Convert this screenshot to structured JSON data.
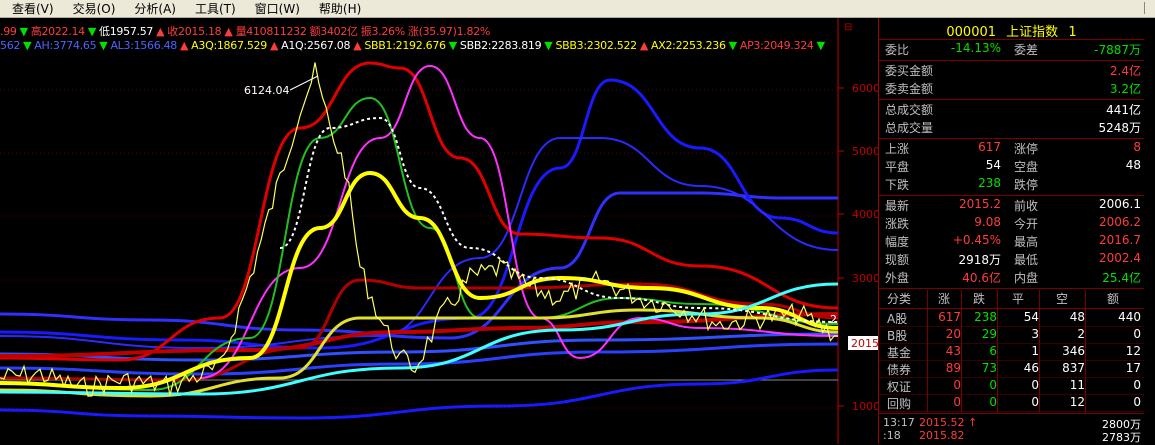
{
  "menu": [
    "查看(V)",
    "交易(O)",
    "分析(A)",
    "工具(T)",
    "窗口(W)",
    "帮助(H)"
  ],
  "info_line1": [
    {
      "t": ".99",
      "c": "c-red"
    },
    {
      "t": "▼",
      "c": "c-grn"
    },
    {
      "t": "高2022.14",
      "c": "c-red"
    },
    {
      "t": "▼",
      "c": "c-grn"
    },
    {
      "t": "低1957.57",
      "c": "c-wht"
    },
    {
      "t": "▲",
      "c": "c-red"
    },
    {
      "t": "收2015.18",
      "c": "c-red"
    },
    {
      "t": "▲",
      "c": "c-red"
    },
    {
      "t": "量410811232",
      "c": "c-red"
    },
    {
      "t": "额3402亿",
      "c": "c-red"
    },
    {
      "t": "振3.26%",
      "c": "c-red"
    },
    {
      "t": "涨(35.97)1.82%",
      "c": "c-red"
    }
  ],
  "info_line2": [
    {
      "t": "562",
      "c": "c-blu"
    },
    {
      "t": "▼",
      "c": "c-grn"
    },
    {
      "t": "AH:3774.65",
      "c": "c-blu"
    },
    {
      "t": "▼",
      "c": "c-grn"
    },
    {
      "t": "AL3:1566.48",
      "c": "c-blu"
    },
    {
      "t": "▲",
      "c": "c-red"
    },
    {
      "t": "A3Q:1867.529",
      "c": "c-yel"
    },
    {
      "t": "▲",
      "c": "c-red"
    },
    {
      "t": "A1Q:2567.08",
      "c": "c-wht"
    },
    {
      "t": "▲",
      "c": "c-red"
    },
    {
      "t": "SBB1:2192.676",
      "c": "c-yel"
    },
    {
      "t": "▼",
      "c": "c-grn"
    },
    {
      "t": "SBB2:2283.819",
      "c": "c-wht"
    },
    {
      "t": "▼",
      "c": "c-grn"
    },
    {
      "t": "SBB3:2302.522",
      "c": "c-yel"
    },
    {
      "t": "▲",
      "c": "c-red"
    },
    {
      "t": "AX2:2253.236",
      "c": "c-yel"
    },
    {
      "t": "▼",
      "c": "c-grn"
    },
    {
      "t": "AP3:2049.324",
      "c": "c-red"
    },
    {
      "t": "▼",
      "c": "c-grn"
    }
  ],
  "chart": {
    "peak_label": "6124.04",
    "y_ticks": [
      "6000",
      "5000",
      "4000",
      "3000",
      "1000"
    ],
    "current_price_label": "2015",
    "right_edge_label": "2"
  },
  "panel": {
    "code": "000001",
    "name": "上证指数",
    "suffix": "1",
    "rows_a": [
      {
        "label": "委比",
        "value": "-14.13%",
        "label2": "委差",
        "value2": "-7887万"
      }
    ],
    "rows_b": [
      {
        "label": "委买金额",
        "value": "2.4亿"
      },
      {
        "label": "委卖金额",
        "value": "3.2亿"
      }
    ],
    "rows_c": [
      {
        "label": "总成交额",
        "value": "441亿"
      },
      {
        "label": "总成交量",
        "value": "5248万"
      }
    ],
    "rows_d": [
      {
        "label": "上涨",
        "value": "617",
        "label2": "涨停",
        "value2": "8"
      },
      {
        "label": "平盘",
        "value": "54",
        "label2": "空盘",
        "value2": "48"
      },
      {
        "label": "下跌",
        "value": "238",
        "label2": "跌停",
        "value2": ""
      }
    ],
    "rows_e": [
      {
        "label": "最新",
        "value": "2015.2",
        "label2": "前收",
        "value2": "2006.1"
      },
      {
        "label": "涨跌",
        "value": "9.08",
        "label2": "今开",
        "value2": "2006.2"
      },
      {
        "label": "幅度",
        "value": "+0.45%",
        "label2": "最高",
        "value2": "2016.7"
      },
      {
        "label": "现额",
        "value": "2918万",
        "label2": "最低",
        "value2": "2002.4"
      },
      {
        "label": "外盘",
        "value": "40.6亿",
        "label2": "内盘",
        "value2": "25.4亿"
      }
    ],
    "table_headers": [
      "分类",
      "涨",
      "跌",
      "平",
      "空",
      "额"
    ],
    "table_rows": [
      [
        "A股",
        "617",
        "238",
        "54",
        "48",
        "440"
      ],
      [
        "B股",
        "20",
        "29",
        "3",
        "2",
        "0"
      ],
      [
        "基金",
        "43",
        "6",
        "1",
        "346",
        "12"
      ],
      [
        "债券",
        "89",
        "73",
        "46",
        "837",
        "17"
      ],
      [
        "权证",
        "0",
        "0",
        "0",
        "11",
        "0"
      ],
      [
        "回购",
        "0",
        "0",
        "0",
        "12",
        "0"
      ]
    ],
    "ticks": [
      {
        "time": "13:17",
        "price": "2015.52",
        "arrow": "↑",
        "vol": "2800万"
      },
      {
        "time": ":18",
        "price": "2015.82",
        "arrow": "",
        "vol": "2783万"
      }
    ]
  }
}
